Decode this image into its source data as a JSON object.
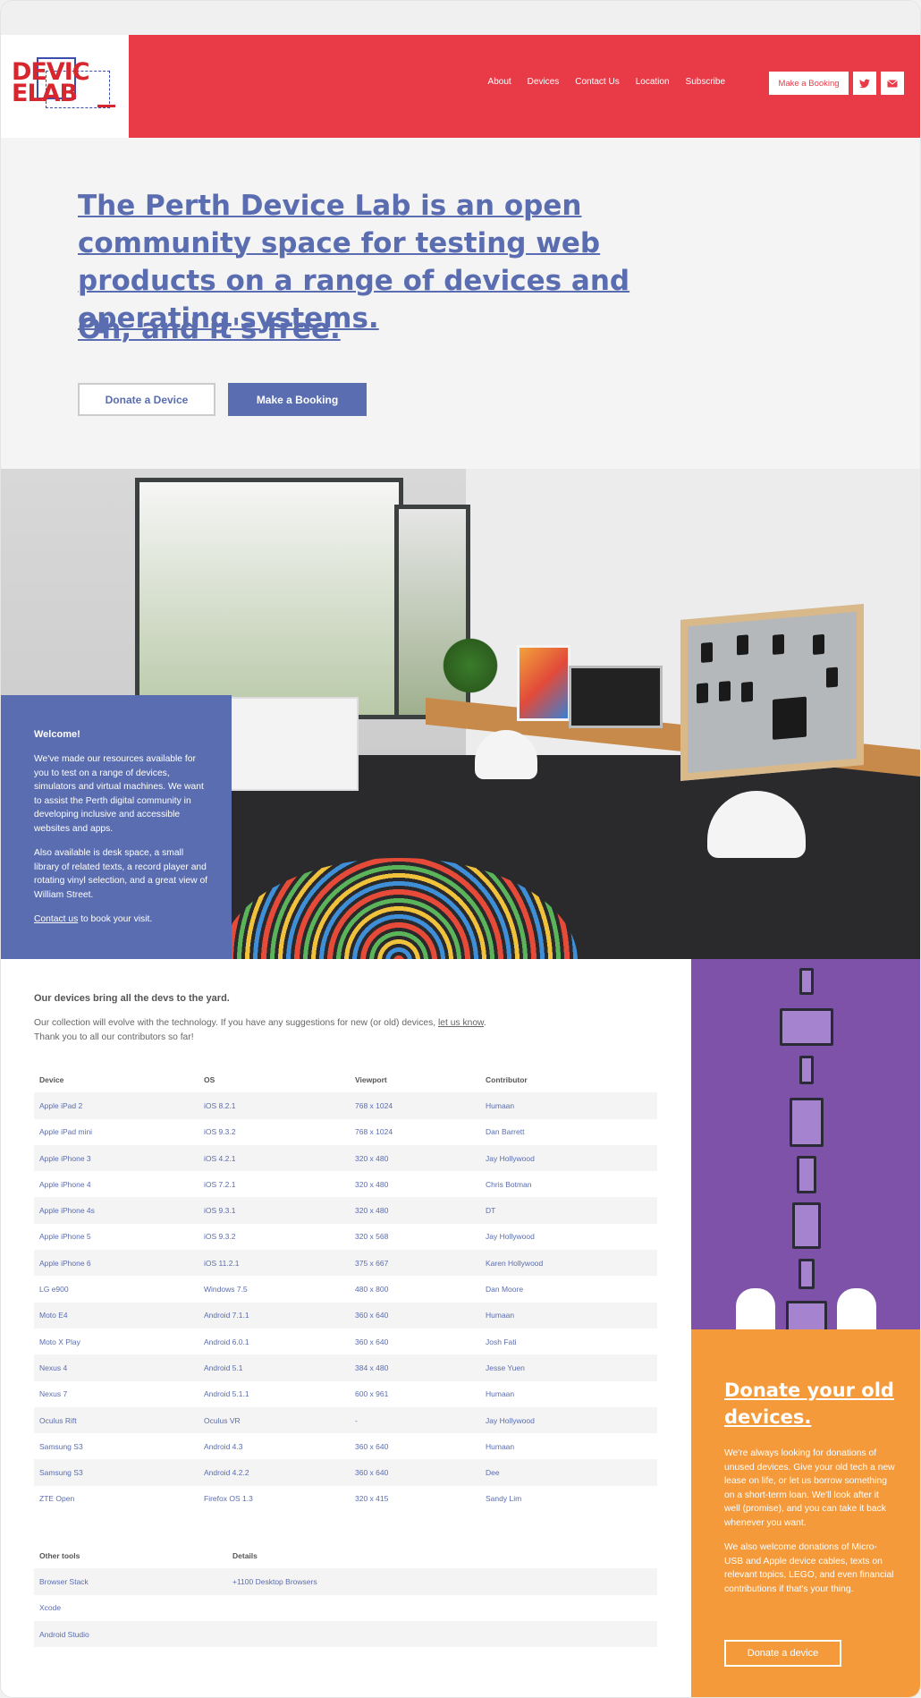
{
  "brand": {
    "logo_line1": "DEVIC",
    "logo_line2": "ELAB"
  },
  "nav": {
    "items": [
      "About",
      "Devices",
      "Contact Us",
      "Location",
      "Subscribe"
    ],
    "booking_label": "Make a Booking",
    "twitter_icon": "twitter-icon",
    "mail_icon": "mail-icon"
  },
  "hero": {
    "title": "The Perth Device Lab is an open community space for testing web products on a range of devices and operating systems.",
    "subtitle": "Oh, and it's free.",
    "donate_label": "Donate a Device",
    "booking_label": "Make a Booking"
  },
  "welcome": {
    "title": "Welcome!",
    "p1": "We've made our resources available for you to test on a range of devices, simulators and virtual machines. We want to assist the Perth digital community in developing inclusive and accessible websites and apps.",
    "p2": "Also available is desk space, a small library of related texts, a record player and rotating vinyl selection, and a great view of William Street.",
    "p3_link": "Contact us",
    "p3_rest": " to book your visit."
  },
  "devices": {
    "title": "Our devices bring all the devs to the yard.",
    "intro_pre": "Our collection will evolve with the technology. If you have any suggestions for new (or old) devices, ",
    "intro_link": "let us know",
    "intro_post": ".",
    "intro_line2": "Thank you to all our contributors so far!",
    "headers": [
      "Device",
      "OS",
      "Viewport",
      "Contributor"
    ],
    "rows": [
      [
        "Apple iPad 2",
        "iOS 8.2.1",
        "768 x 1024",
        "Humaan"
      ],
      [
        "Apple iPad mini",
        "iOS 9.3.2",
        "768 x 1024",
        "Dan Barrett"
      ],
      [
        "Apple iPhone 3",
        "iOS 4.2.1",
        "320 x 480",
        "Jay Hollywood"
      ],
      [
        "Apple iPhone 4",
        "iOS 7.2.1",
        "320 x 480",
        "Chris Botman"
      ],
      [
        "Apple iPhone 4s",
        "iOS 9.3.1",
        "320 x 480",
        "DT"
      ],
      [
        "Apple iPhone 5",
        "iOS 9.3.2",
        "320 x 568",
        "Jay Hollywood"
      ],
      [
        "Apple iPhone 6",
        "iOS 11.2.1",
        "375 x 667",
        "Karen Hollywood"
      ],
      [
        "LG e900",
        "Windows 7.5",
        "480 x 800",
        "Dan Moore"
      ],
      [
        "Moto E4",
        "Android 7.1.1",
        "360 x 640",
        "Humaan"
      ],
      [
        "Moto X Play",
        "Android 6.0.1",
        "360 x 640",
        "Josh Fati"
      ],
      [
        "Nexus 4",
        "Android 5.1",
        "384 x 480",
        "Jesse Yuen"
      ],
      [
        "Nexus 7",
        "Android 5.1.1",
        "600 x 961",
        "Humaan"
      ],
      [
        "Oculus Rift",
        "Oculus VR",
        "-",
        "Jay Hollywood"
      ],
      [
        "Samsung S3",
        "Android 4.3",
        "360 x 640",
        "Humaan"
      ],
      [
        "Samsung S3",
        "Android 4.2.2",
        "360 x 640",
        "Dee"
      ],
      [
        "ZTE Open",
        "Firefox OS 1.3",
        "320 x 415",
        "Sandy Lim"
      ]
    ],
    "tools_headers": [
      "Other tools",
      "Details"
    ],
    "tools_rows": [
      [
        "Browser Stack",
        "+1100 Desktop Browsers"
      ],
      [
        "Xcode",
        ""
      ],
      [
        "Android Studio",
        ""
      ]
    ]
  },
  "donate": {
    "title": "Donate your old devices.",
    "p1": "We're always looking for donations of unused devices. Give your old tech a new lease on life, or let us borrow something on a short-term loan. We'll look after it well (promise), and you can take it back whenever you want.",
    "p2": "We also welcome donations of Micro-USB and Apple device cables, texts on relevant topics, LEGO, and even financial contributions if that's your thing.",
    "button_label": "Donate a device"
  },
  "colors": {
    "brand_red": "#e93a47",
    "accent_blue": "#5a6db0",
    "purple": "#7e52a9",
    "orange": "#f59a3a"
  }
}
